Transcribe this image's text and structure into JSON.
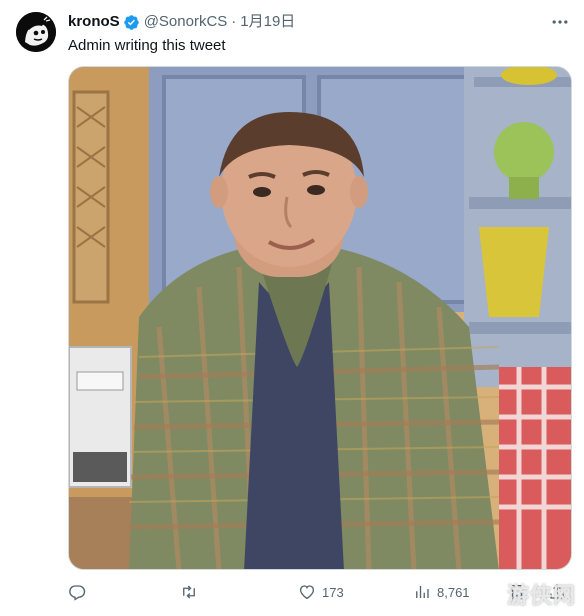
{
  "tweet": {
    "author": {
      "display_name": "kronoS",
      "handle": "@SonorkCS",
      "verified": true
    },
    "separator": "·",
    "date": "1月19日",
    "text": "Admin writing this tweet",
    "media": {
      "alt": "Man in plaid shirt making an awkward face in a kitchen"
    },
    "actions": {
      "replies": "",
      "retweets": "",
      "likes": "173",
      "views": "8,761"
    }
  },
  "watermark": "游侠网",
  "colors": {
    "text_primary": "#0f1419",
    "text_secondary": "#536471",
    "verified": "#1d9bf0",
    "border": "#cfd9de"
  },
  "icons": [
    "more-icon",
    "verified-icon",
    "reply-icon",
    "retweet-icon",
    "like-icon",
    "views-icon",
    "bookmark-icon",
    "share-icon"
  ]
}
